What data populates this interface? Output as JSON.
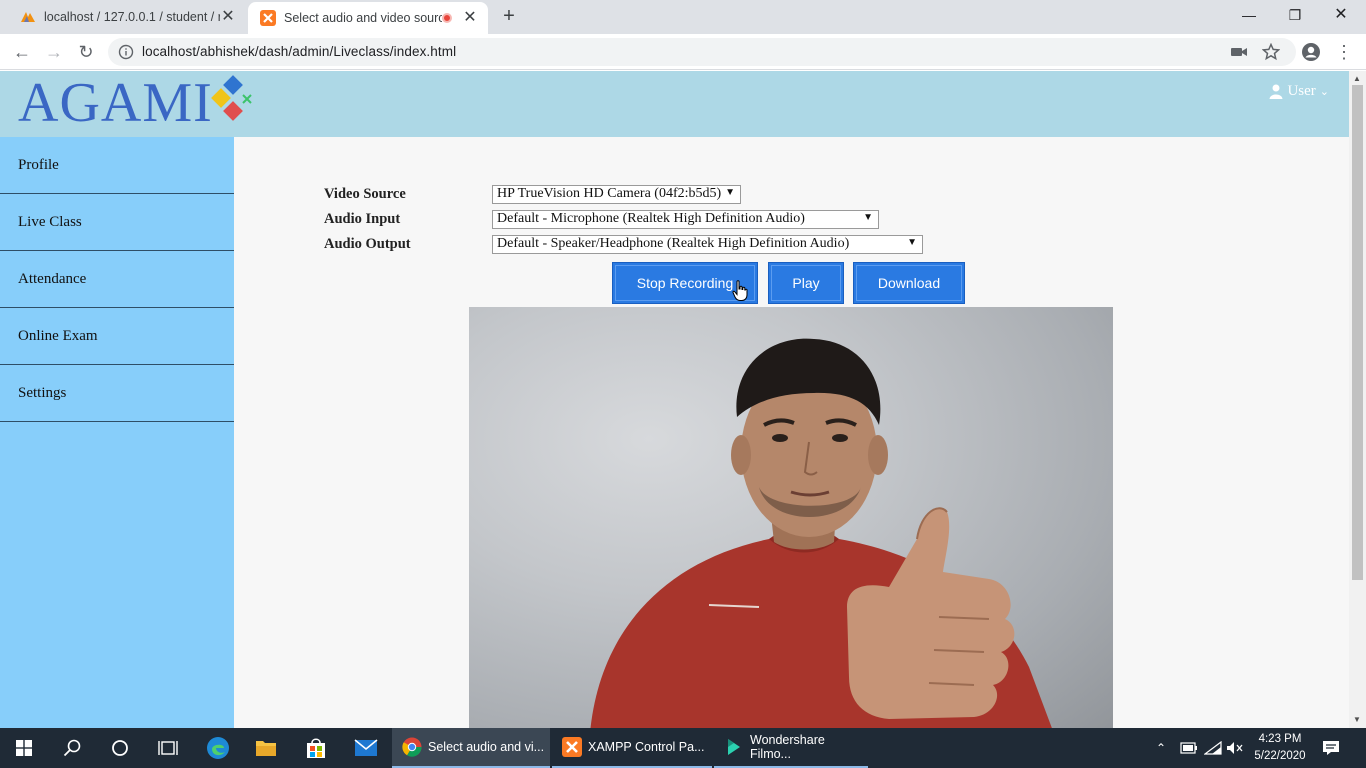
{
  "browser": {
    "tabs": [
      {
        "title": "localhost / 127.0.0.1 / student / r",
        "active": false
      },
      {
        "title": "Select audio and video sourc",
        "active": true
      }
    ],
    "url": "localhost/abhishek/dash/admin/Liveclass/index.html"
  },
  "header": {
    "logo": "AGAMI",
    "user_label": "User"
  },
  "sidebar": {
    "items": [
      {
        "label": "Profile"
      },
      {
        "label": "Live Class"
      },
      {
        "label": "Attendance"
      },
      {
        "label": "Online Exam"
      },
      {
        "label": "Settings"
      }
    ]
  },
  "form": {
    "video_source": {
      "label": "Video Source",
      "value": "HP TrueVision HD Camera (04f2:b5d5)"
    },
    "audio_input": {
      "label": "Audio Input",
      "value": "Default - Microphone (Realtek High Definition Audio)"
    },
    "audio_output": {
      "label": "Audio Output",
      "value": "Default - Speaker/Headphone (Realtek High Definition Audio)"
    }
  },
  "buttons": {
    "stop_recording": "Stop Recording",
    "play": "Play",
    "download": "Download"
  },
  "taskbar": {
    "apps": [
      {
        "label": "Select audio and vi...",
        "active": true
      },
      {
        "label": "XAMPP Control Pa...",
        "active": false
      },
      {
        "label": "Wondershare Filmo...",
        "active": false
      }
    ],
    "time": "4:23 PM",
    "date": "5/22/2020"
  },
  "colors": {
    "header_bg": "#add8e6",
    "sidebar_bg": "#87cefa",
    "button_bg": "#2a7ae2",
    "logo_color": "#3a67c4"
  }
}
